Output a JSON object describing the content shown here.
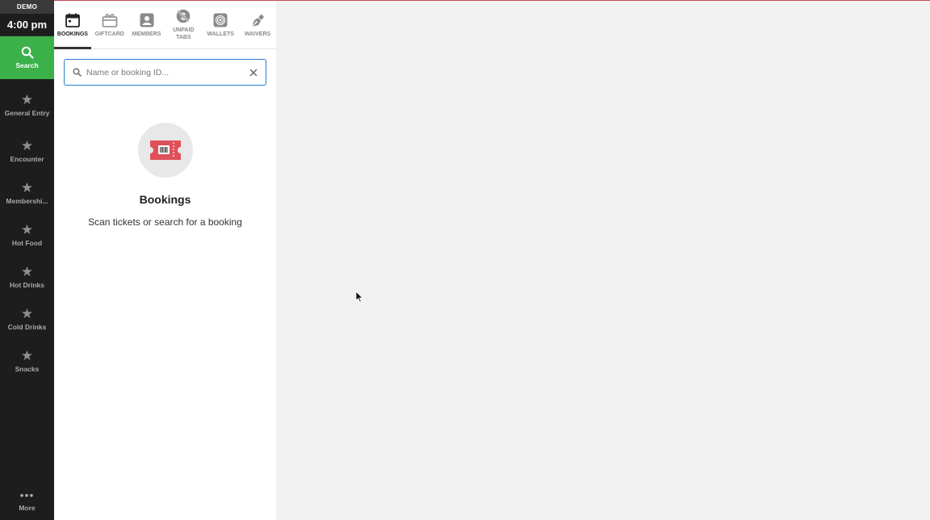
{
  "sidebar": {
    "brand": "DEMO",
    "clock": "4:00 pm",
    "search_label": "Search",
    "items": [
      {
        "label": "General Entry"
      },
      {
        "label": "Encounter"
      },
      {
        "label": "Membershi..."
      },
      {
        "label": "Hot Food"
      },
      {
        "label": "Hot Drinks"
      },
      {
        "label": "Cold Drinks"
      },
      {
        "label": "Snacks"
      }
    ],
    "more_label": "More"
  },
  "tabs": [
    {
      "label": "BOOKINGS",
      "icon": "calendar-icon",
      "active": true
    },
    {
      "label": "GIFTCARD",
      "icon": "giftcard-icon",
      "active": false
    },
    {
      "label": "MEMBERS",
      "icon": "member-icon",
      "active": false
    },
    {
      "label": "UNPAID TABS",
      "icon": "unpaid-tabs-icon",
      "active": false
    },
    {
      "label": "WALLETS",
      "icon": "wallet-icon",
      "active": false
    },
    {
      "label": "WAIVERS",
      "icon": "pen-icon",
      "active": false
    }
  ],
  "search": {
    "placeholder": "Name or booking ID..."
  },
  "empty_state": {
    "title": "Bookings",
    "subtitle": "Scan tickets or search for a booking"
  },
  "colors": {
    "accent": "#3cb14a",
    "focus": "#2b7bd0",
    "ticket": "#e0505a"
  }
}
